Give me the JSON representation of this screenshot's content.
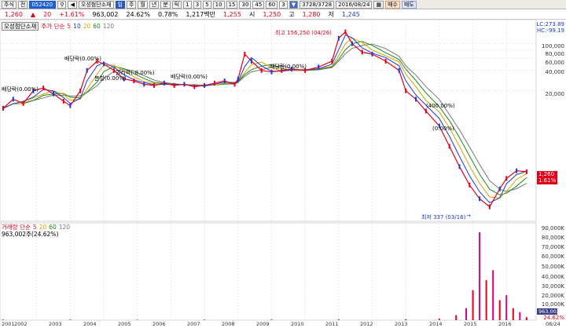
{
  "toolbar": {
    "menu_label": "주식",
    "search_label": "전",
    "code_value": "052420",
    "stock_name": "오성첨단소재",
    "period_buttons": [
      "일",
      "주",
      "월",
      "년",
      "분",
      "틱"
    ],
    "selected_period": "일",
    "interval_buttons": [
      "1",
      "3",
      "5",
      "10",
      "15",
      "30",
      "45",
      "60",
      "3"
    ],
    "count_value": "3728/3728",
    "date_value": "2016/08/24",
    "buy_label": "매수",
    "sell_label": "매도"
  },
  "quote": {
    "price": "1,260",
    "change": "20",
    "change_pct": "+1.61%",
    "volume": "963,002",
    "turnover_pct": "24.62%",
    "ratio": "0.78%",
    "amount": "1,217백만",
    "open_label": "시",
    "open": "1,250",
    "high_label": "고",
    "high": "1,280",
    "low_label": "저",
    "low": "1,245",
    "base_label": "",
    "base": "1,255"
  },
  "price_panel": {
    "legend_name": "오성첨단소재",
    "ma_label": "주가 단순",
    "ma_periods": [
      "5",
      "10",
      "20",
      "60",
      "120"
    ],
    "lc_label": "LC:273.89",
    "hc_label": "HC:-99.19",
    "high_annot": "최고 156,250 (04/26)",
    "low_annot": "최저 337 (03/16)",
    "current_price_tag": "1,260",
    "current_pct_tag": "1.61%",
    "annotations": [
      "배당락(0.00%)",
      "권리락(-8.00%)",
      "배당락(0.00%)",
      "배당락(0.00%)",
      "배당락(0.00%)",
      "(400.00%)",
      "(0.00%)",
      "분할(0.00%)"
    ]
  },
  "volume_panel": {
    "legend_label": "거래량 단순",
    "ma_periods": [
      "5",
      "20",
      "60",
      "120"
    ],
    "current_value_label": "963,002주(24.62%)",
    "tag_value": "963,002",
    "tag_pct": "24.62%"
  },
  "chart_data": {
    "type": "line",
    "title": "",
    "log_scale": true,
    "price_axis_ticks": [
      "100,000",
      "80,000",
      "60,000",
      "40,000",
      "20,000"
    ],
    "volume_axis_ticks": [
      "90,000K",
      "80,000K",
      "70,000K",
      "60,000K",
      "50,000K",
      "40,000K",
      "30,000K",
      "20,000K",
      "10,000K"
    ],
    "x_tick_labels": [
      "2001",
      "2002",
      "2003",
      "2004",
      "2005",
      "2006",
      "2007",
      "2008",
      "2009",
      "2010",
      "2011",
      "2012",
      "2013",
      "2014",
      "2015",
      "2016",
      "08/24"
    ],
    "series": [
      {
        "name": "",
        "x": [
          2001.0,
          2001.3,
          2001.6,
          2001.9,
          2002.2,
          2002.5,
          2002.8,
          2003.0,
          2003.3,
          2003.5,
          2003.8,
          2004.0,
          2004.3,
          2004.6,
          2004.9,
          2005.2,
          2005.5,
          2005.8,
          2006.1,
          2006.4,
          2006.7,
          2007.0,
          2007.3,
          2007.6,
          2007.9,
          2008.0,
          2008.2,
          2008.4,
          2008.7,
          2009.0,
          2009.3,
          2009.6,
          2010.0,
          2010.4,
          2010.8,
          2011.0,
          2011.2,
          2011.4,
          2011.7,
          2012.0,
          2012.4,
          2012.8,
          2013.0,
          2013.3,
          2013.6,
          2014.0,
          2014.3,
          2014.6,
          2014.9,
          2015.2,
          2015.5,
          2015.8,
          2016.0,
          2016.3,
          2016.6
        ],
        "values": [
          11000,
          15000,
          13000,
          20000,
          22000,
          18000,
          14000,
          12000,
          20000,
          40000,
          55000,
          50000,
          40000,
          30000,
          28000,
          25000,
          24000,
          26000,
          24000,
          25000,
          23000,
          24000,
          26000,
          28000,
          25000,
          30000,
          70000,
          55000,
          40000,
          38000,
          40000,
          42000,
          40000,
          45000,
          55000,
          120000,
          150000,
          100000,
          75000,
          70000,
          55000,
          40000,
          20000,
          15000,
          10000,
          6000,
          3000,
          1500,
          800,
          500,
          380,
          700,
          1000,
          1300,
          1260
        ]
      }
    ],
    "volume_series": {
      "name": "",
      "unit": "K",
      "x": [
        2001.0,
        2003.0,
        2005.0,
        2007.0,
        2009.0,
        2011.0,
        2013.0,
        2014.0,
        2014.5,
        2014.8,
        2015.0,
        2015.2,
        2015.4,
        2015.6,
        2015.8,
        2016.0,
        2016.2,
        2016.4,
        2016.6
      ],
      "values": [
        500,
        600,
        400,
        500,
        600,
        700,
        900,
        1500,
        5000,
        12000,
        30000,
        88000,
        40000,
        50000,
        20000,
        25000,
        12000,
        8000,
        3000
      ]
    }
  }
}
